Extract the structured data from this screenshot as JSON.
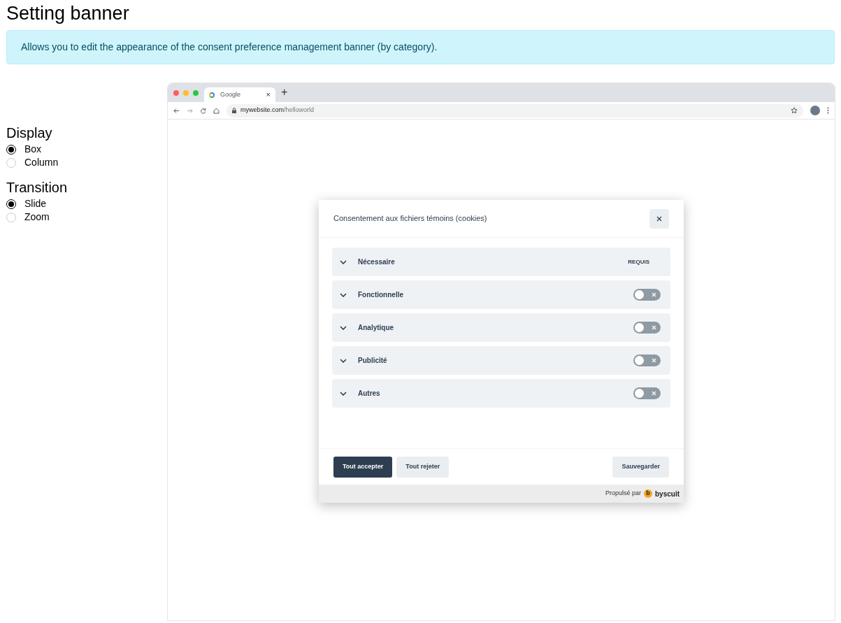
{
  "title": "Setting banner",
  "info": "Allows you to edit the appearance of the consent preference management banner (by category).",
  "option_groups": [
    {
      "label": "Display",
      "options": [
        {
          "label": "Box",
          "selected": true
        },
        {
          "label": "Column",
          "selected": false
        }
      ]
    },
    {
      "label": "Transition",
      "options": [
        {
          "label": "Slide",
          "selected": true
        },
        {
          "label": "Zoom",
          "selected": false
        }
      ]
    }
  ],
  "preview": {
    "tab": {
      "title": "Google",
      "close": "×"
    },
    "new_tab": "+",
    "url_host": "mywebsite.com",
    "url_path": "/helloworld",
    "banner": {
      "title": "Consentement aux fichiers témoins (cookies)",
      "categories": [
        {
          "kind": "required",
          "label": "Nécessaire",
          "badge": "REQUIS"
        },
        {
          "kind": "toggle",
          "label": "Fonctionnelle",
          "on": false
        },
        {
          "kind": "toggle",
          "label": "Analytique",
          "on": false
        },
        {
          "kind": "toggle",
          "label": "Publicité",
          "on": false
        },
        {
          "kind": "toggle",
          "label": "Autres",
          "on": false
        }
      ],
      "buttons": [
        {
          "kind": "primary",
          "label": "Tout accepter"
        },
        {
          "kind": "secondary",
          "label": "Tout rejeter"
        },
        {
          "kind": "save",
          "label": "Sauvegarder"
        }
      ],
      "footer": "Propulsé par",
      "logo_mark": "b",
      "logo_text": "byscuit"
    }
  }
}
